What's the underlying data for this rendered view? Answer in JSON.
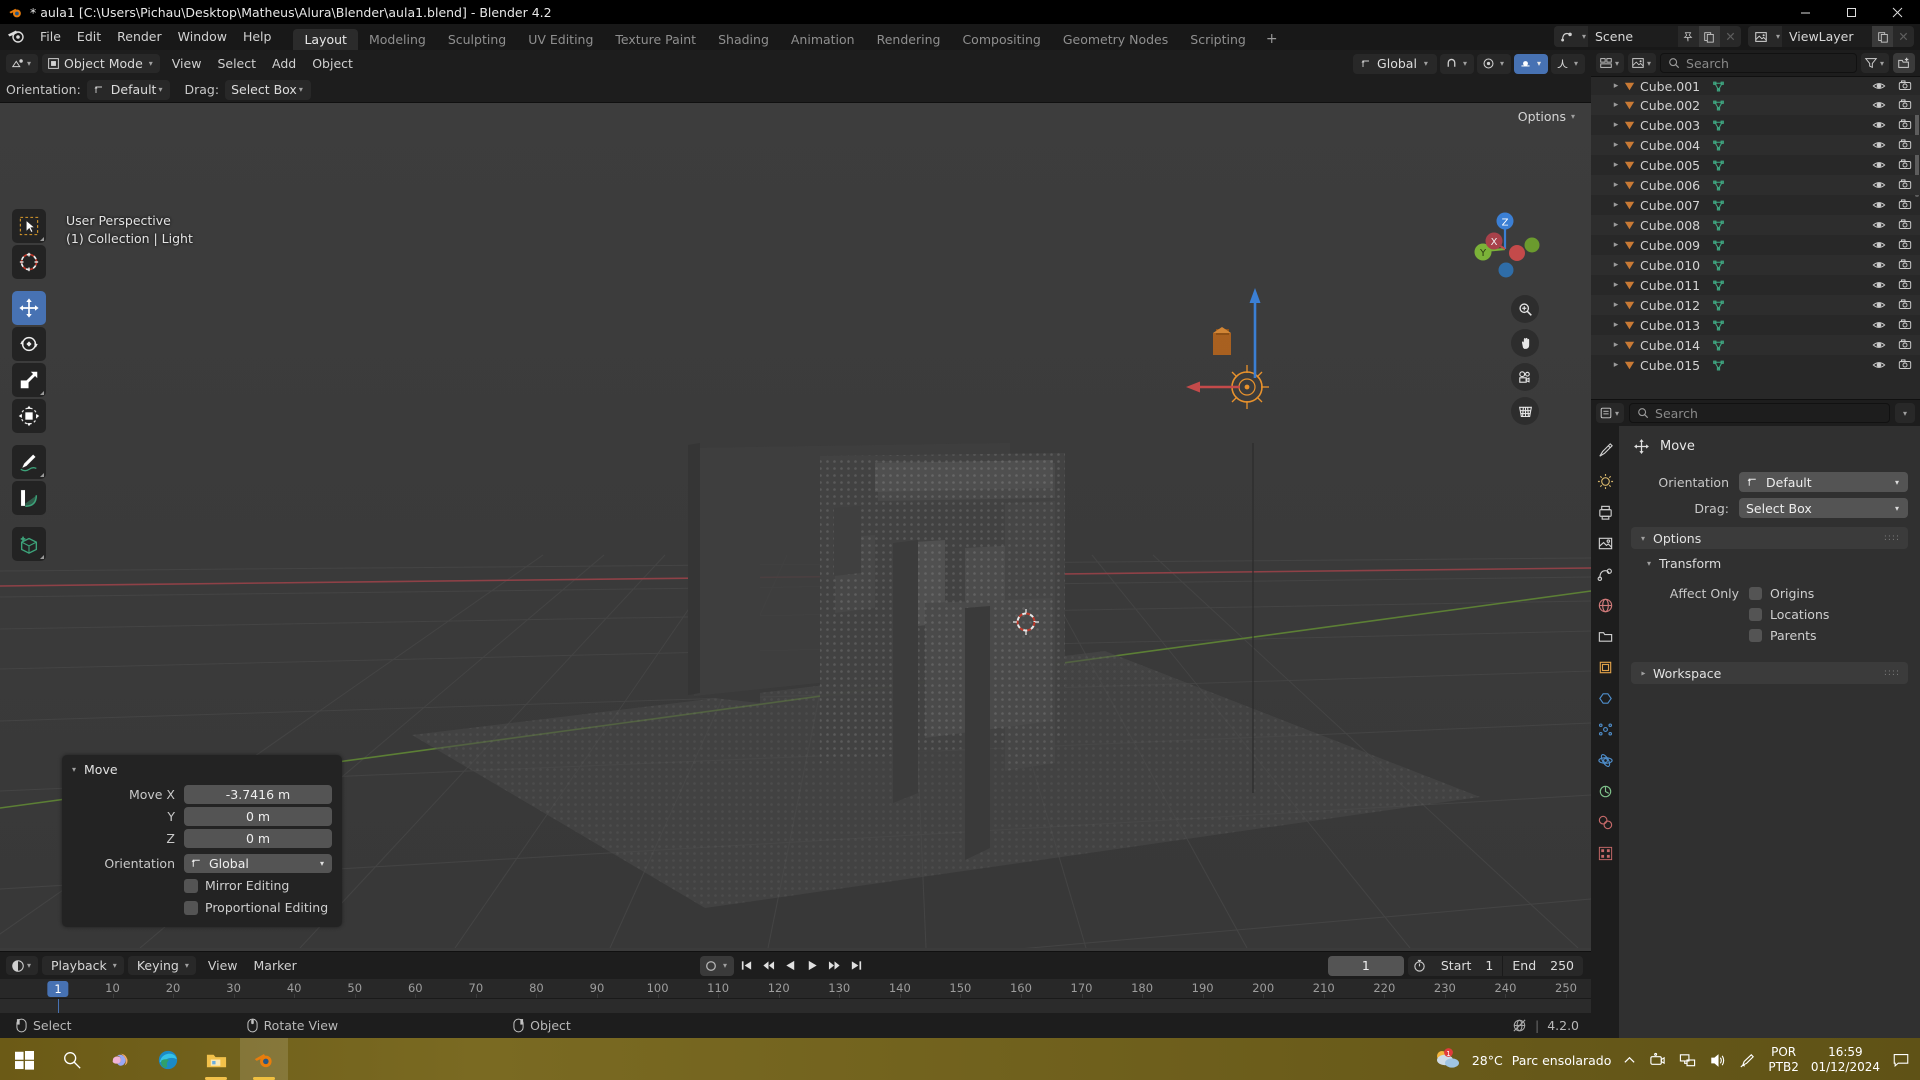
{
  "titlebar": {
    "title": "* aula1 [C:\\Users\\Pichau\\Desktop\\Matheus\\Alura\\Blender\\aula1.blend] - Blender 4.2",
    "minimize": "minimize-icon",
    "maximize": "maximize-icon",
    "close": "close-icon"
  },
  "topbar": {
    "menus": [
      "File",
      "Edit",
      "Render",
      "Window",
      "Help"
    ],
    "workspaces": [
      "Layout",
      "Modeling",
      "Sculpting",
      "UV Editing",
      "Texture Paint",
      "Shading",
      "Animation",
      "Rendering",
      "Compositing",
      "Geometry Nodes",
      "Scripting"
    ],
    "active_workspace": "Layout",
    "add_workspace": "+",
    "scene_name": "Scene",
    "viewlayer_name": "ViewLayer"
  },
  "viewport_header": {
    "mode": "Object Mode",
    "menus": [
      "View",
      "Select",
      "Add",
      "Object"
    ],
    "transform_orientation": "Global",
    "orientation_label": "Orientation:",
    "orientation_value": "Default",
    "drag_label": "Drag:",
    "drag_value": "Select Box",
    "options_label": "Options"
  },
  "viewport": {
    "overlay_line1": "User Perspective",
    "overlay_line2": "(1) Collection | Light",
    "gizmo_axes": [
      "X",
      "Y",
      "Z"
    ],
    "tools": [
      "tweak-select-tool",
      "cursor-tool",
      "move-tool",
      "rotate-tool",
      "scale-tool",
      "transform-tool",
      "annotate-tool",
      "measure-tool",
      "add-cube-tool"
    ],
    "active_tool": "move-tool"
  },
  "operator_panel": {
    "title": "Move",
    "rows": [
      {
        "label": "Move X",
        "value": "-3.7416 m"
      },
      {
        "label": "Y",
        "value": "0 m"
      },
      {
        "label": "Z",
        "value": "0 m"
      }
    ],
    "orientation_label": "Orientation",
    "orientation_value": "Global",
    "checkboxes": [
      "Mirror Editing",
      "Proportional Editing"
    ]
  },
  "timeline": {
    "menus": [
      "Playback",
      "Keying",
      "View",
      "Marker"
    ],
    "current_frame": "1",
    "start_label": "Start",
    "start_value": "1",
    "end_label": "End",
    "end_value": "250",
    "ticks": [
      "1",
      "10",
      "20",
      "30",
      "40",
      "50",
      "60",
      "70",
      "80",
      "90",
      "100",
      "110",
      "120",
      "130",
      "140",
      "150",
      "160",
      "170",
      "180",
      "190",
      "200",
      "210",
      "220",
      "230",
      "240",
      "250"
    ],
    "playhead_label": "1"
  },
  "statusbar": {
    "items": [
      "Select",
      "Rotate View",
      "Object"
    ],
    "version": "4.2.0"
  },
  "outliner": {
    "search_placeholder": "Search",
    "items": [
      "Cube.001",
      "Cube.002",
      "Cube.003",
      "Cube.004",
      "Cube.005",
      "Cube.006",
      "Cube.007",
      "Cube.008",
      "Cube.009",
      "Cube.010",
      "Cube.011",
      "Cube.012",
      "Cube.013",
      "Cube.014",
      "Cube.015"
    ]
  },
  "properties": {
    "search_placeholder": "Search",
    "title": "Move",
    "orientation_label": "Orientation",
    "orientation_value": "Default",
    "drag_label": "Drag:",
    "drag_value": "Select Box",
    "options_panel": "Options",
    "transform_panel": "Transform",
    "affect_only_label": "Affect Only",
    "affect_only_options": [
      "Origins",
      "Locations",
      "Parents"
    ],
    "workspace_panel": "Workspace"
  },
  "taskbar": {
    "apps": [
      "start-button",
      "search-icon",
      "copilot-icon",
      "edge-icon",
      "file-explorer-icon",
      "blender-icon"
    ],
    "weather_temp": "28°C",
    "weather_desc": "Parc ensolarado",
    "lang_line1": "POR",
    "lang_line2": "PTB2",
    "time": "16:59",
    "date": "01/12/2024"
  },
  "colors": {
    "accent": "#4772b3",
    "viewport_bg": "#3b3b3b",
    "header_bg": "#1d1d1d",
    "axis_x": "#c44a4a",
    "axis_y": "#7bb238",
    "axis_z": "#3b7fd4"
  }
}
